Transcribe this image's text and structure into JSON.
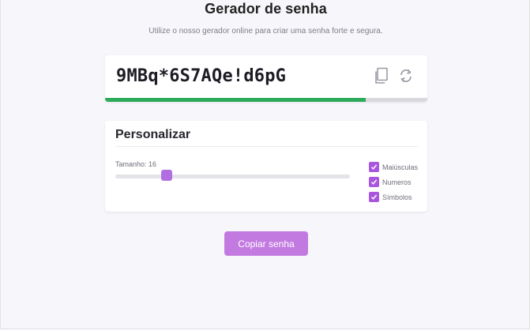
{
  "header": {
    "title": "Gerador de senha",
    "subtitle": "Utilize o nosso gerador online para criar uma senha forte e segura."
  },
  "password": {
    "value": "9MBq*6S7AQe!d6pG",
    "copy_icon": "copy-icon",
    "refresh_icon": "refresh-icon",
    "strength_fraction": 0.81,
    "strength_color": "#2eab5a"
  },
  "customize": {
    "title": "Personalizar",
    "length_label": "Tamanho: 16",
    "length_value": 16,
    "length_slider_fraction": 0.22,
    "options": [
      {
        "label": "Maiúsculas",
        "checked": true
      },
      {
        "label": "Numeros",
        "checked": true
      },
      {
        "label": "Símbolos",
        "checked": true
      }
    ]
  },
  "actions": {
    "copy_label": "Copiar senha"
  },
  "colors": {
    "accent": "#c27ae0",
    "checkbox": "#a855e0",
    "strength": "#2eab5a"
  }
}
